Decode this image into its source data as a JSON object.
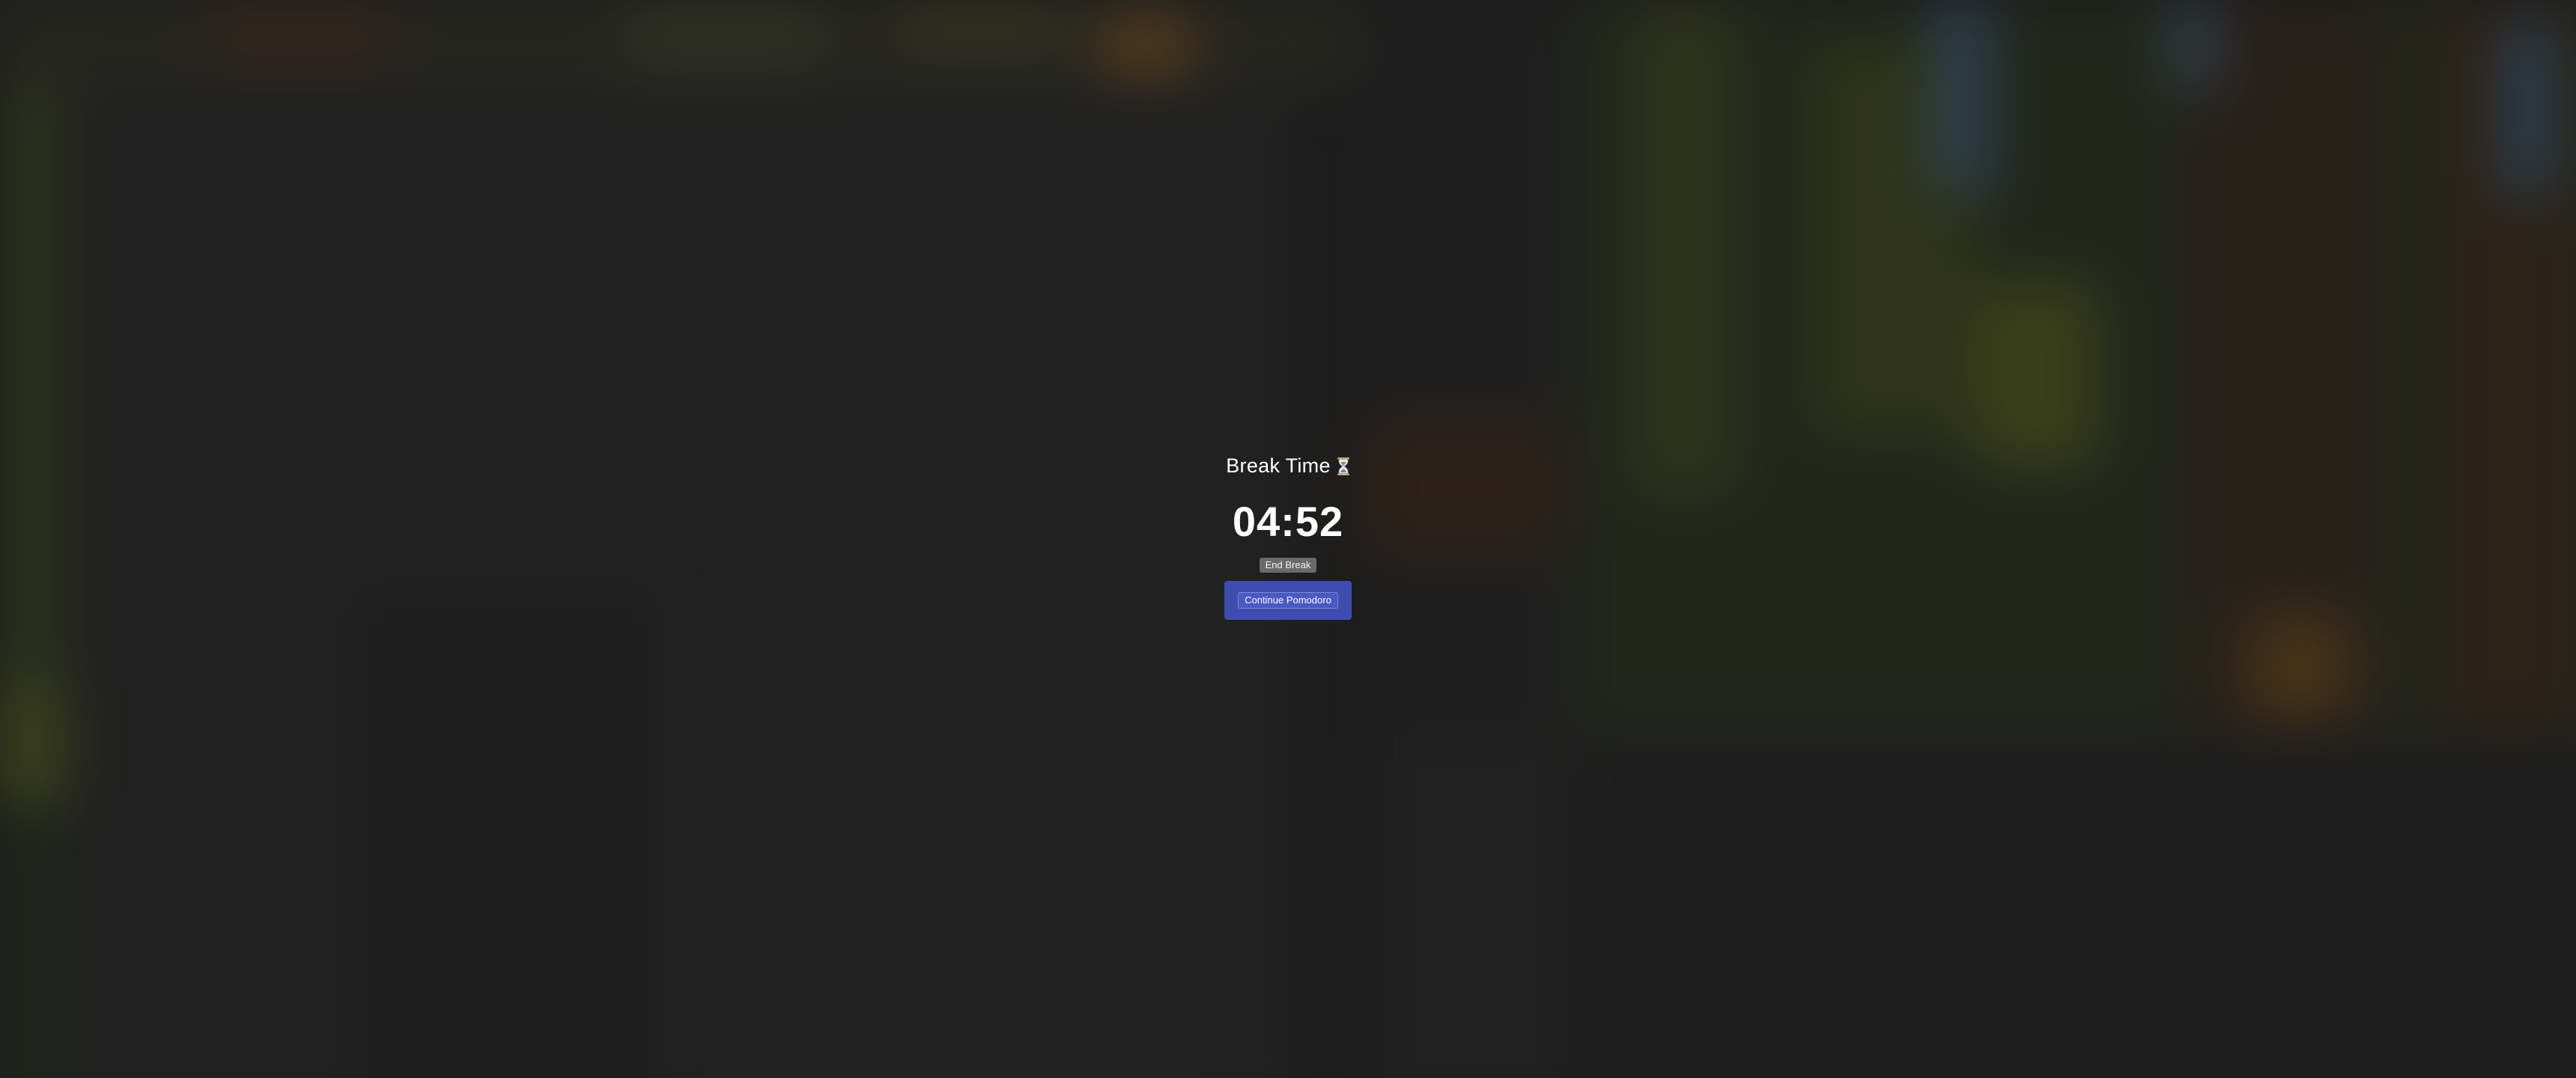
{
  "break_overlay": {
    "title": "Break Time",
    "title_icon": "hourglass-icon",
    "timer": "04:52",
    "end_break_label": "End Break",
    "continue_label": "Continue Pomodoro"
  },
  "colors": {
    "accent": "#3f4db0",
    "button_secondary": "#6a6a6a",
    "overlay_dim": "#1c1c1c"
  }
}
